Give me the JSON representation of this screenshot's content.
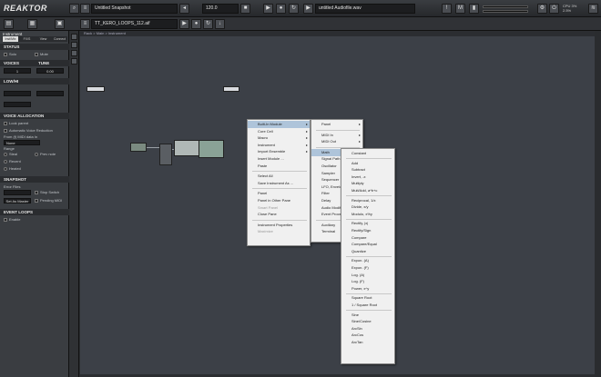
{
  "app": {
    "title": "REAKTOR"
  },
  "toolbar": {
    "snapshot": "Untitled Snapshot",
    "tempo": "120.0",
    "file1": "TT_KERO_LOOPS_112.aif",
    "file2": "untitled Audiofile.wav",
    "cpu": "CPU 3%\n2.5%"
  },
  "left": {
    "tab_title": "Instrument",
    "tabs": [
      "Inst/Mix",
      "FX/S",
      "View",
      "Connect"
    ],
    "status": "STATUS",
    "solo": "Solo",
    "mute": "Mute",
    "voices_head": "VOICES",
    "tune_head": "TUNE",
    "voices_val": "1",
    "tune_val": "0.00",
    "midi_head": "LOW/HI",
    "vcall": "VOICE ALLOCATION",
    "look_parent": "Look parent",
    "auto_reduce": "Automatic Voice Reduction",
    "from_midi": "From (f) MIDI data In",
    "none": "None",
    "range": "Range",
    "steal": "Steal",
    "sem": "Prev note",
    "recent": "Recent",
    "sharked": "Heated",
    "snapshot_head": "SNAPSHOT",
    "error_files": "Error Files",
    "stop_switch": "Stop Switch",
    "set_master": "Set As Master",
    "pending": "Pending MIDI",
    "event_loops": "EVENT LOOPS",
    "enable": "Enable"
  },
  "breadcrumb": [
    "Rack",
    "Main",
    "Instrument"
  ],
  "menu1": [
    {
      "label": "Built-In Module",
      "arrow": true,
      "hl": true
    },
    {
      "label": "Core Cell",
      "arrow": true
    },
    {
      "label": "Macro",
      "arrow": true
    },
    {
      "label": "Instrument",
      "arrow": true
    },
    {
      "label": "Import Ensemble",
      "arrow": true
    },
    {
      "label": "Insert Module ...",
      "arrow": false
    },
    {
      "label": "Paste",
      "arrow": false
    },
    {
      "sep": true
    },
    {
      "label": "Select All",
      "arrow": false
    },
    {
      "label": "Save Instrument As ...",
      "arrow": false
    },
    {
      "sep": true
    },
    {
      "label": "Panel",
      "arrow": false
    },
    {
      "label": "Panel in Other Pane",
      "arrow": false
    },
    {
      "label": "Smart Panel",
      "arrow": false,
      "dis": true
    },
    {
      "label": "Close Pane",
      "arrow": false
    },
    {
      "sep": true
    },
    {
      "label": "Instrument Properties",
      "arrow": false
    },
    {
      "label": "Maximize",
      "arrow": false,
      "dis": true
    }
  ],
  "menu2": [
    {
      "label": "Panel",
      "arrow": true
    },
    {
      "sep": true
    },
    {
      "label": "MIDI In",
      "arrow": true
    },
    {
      "label": "MIDI Out",
      "arrow": true
    },
    {
      "sep": true
    },
    {
      "label": "Math",
      "arrow": true,
      "hl": true
    },
    {
      "label": "Signal Path",
      "arrow": true
    },
    {
      "label": "Oscillator",
      "arrow": true
    },
    {
      "label": "Sampler",
      "arrow": true
    },
    {
      "label": "Sequencer",
      "arrow": true
    },
    {
      "label": "LFO, Envelope",
      "arrow": true
    },
    {
      "label": "Filter",
      "arrow": true
    },
    {
      "label": "Delay",
      "arrow": true
    },
    {
      "label": "Audio Modifier",
      "arrow": true
    },
    {
      "label": "Event Processing",
      "arrow": true
    },
    {
      "sep": true
    },
    {
      "label": "Auxiliary",
      "arrow": true
    },
    {
      "label": "Terminal",
      "arrow": true
    }
  ],
  "menu3": [
    {
      "label": "Constant"
    },
    {
      "sep": true
    },
    {
      "label": "Add"
    },
    {
      "label": "Subtract"
    },
    {
      "label": "Invert, -x"
    },
    {
      "label": "Multiply"
    },
    {
      "label": "Mult/Add, a*b+c"
    },
    {
      "sep": true
    },
    {
      "label": "Reciprocal, 1/x"
    },
    {
      "label": "Divide, x/y"
    },
    {
      "label": "Modulo, x%y"
    },
    {
      "sep": true
    },
    {
      "label": "Rectify, |x|"
    },
    {
      "label": "Rectify/Sign"
    },
    {
      "label": "Compare"
    },
    {
      "label": "Compare/Equal"
    },
    {
      "label": "Quantize"
    },
    {
      "sep": true
    },
    {
      "label": "Expon. (A)"
    },
    {
      "label": "Expon. (F)"
    },
    {
      "label": "Log. (A)"
    },
    {
      "label": "Log. (F)"
    },
    {
      "label": "Power, x^y"
    },
    {
      "sep": true
    },
    {
      "label": "Square Root"
    },
    {
      "label": "1 / Square Root"
    },
    {
      "sep": true
    },
    {
      "label": "Sine"
    },
    {
      "label": "Sine/Cosine"
    },
    {
      "label": "ArcSin"
    },
    {
      "label": "ArcCos"
    },
    {
      "label": "ArcTan"
    }
  ]
}
